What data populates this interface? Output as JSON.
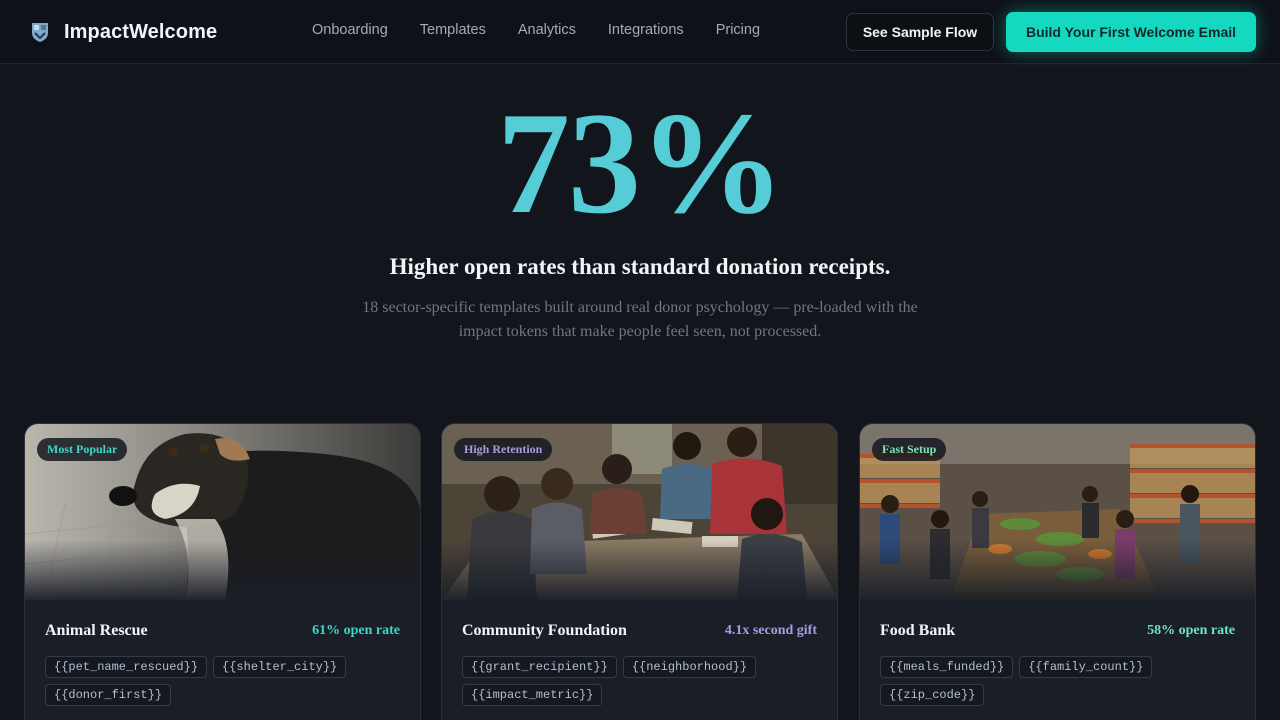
{
  "nav": {
    "brand": "ImpactWelcome",
    "links": [
      "Onboarding",
      "Templates",
      "Analytics",
      "Integrations",
      "Pricing"
    ],
    "secondary_cta": "See Sample Flow",
    "primary_cta": "Build Your First Welcome Email"
  },
  "hero": {
    "stat": "73%",
    "headline": "Higher open rates than standard donation receipts.",
    "subtext": "18 sector-specific templates built around real donor psychology — pre-loaded with the impact tokens that make people feel seen, not processed."
  },
  "colors": {
    "accent": "#14d8c0",
    "stat": "#56ccd6",
    "purple": "#a99be0",
    "background": "#12151c"
  },
  "cards": [
    {
      "badge": "Most Popular",
      "badge_color": "#3fd6c6",
      "title": "Animal Rescue",
      "metric": "61% open rate",
      "metric_color": "#3fd6c6",
      "tokens": [
        "{{pet_name_rescued}}",
        "{{shelter_city}}",
        "{{donor_first}}"
      ]
    },
    {
      "badge": "High Retention",
      "badge_color": "#a99be0",
      "title": "Community Foundation",
      "metric": "4.1x second gift",
      "metric_color": "#a99be0",
      "tokens": [
        "{{grant_recipient}}",
        "{{neighborhood}}",
        "{{impact_metric}}"
      ]
    },
    {
      "badge": "Fast Setup",
      "badge_color": "#7fe3b4",
      "title": "Food Bank",
      "metric": "58% open rate",
      "metric_color": "#6fe3c9",
      "tokens": [
        "{{meals_funded}}",
        "{{family_count}}",
        "{{zip_code}}"
      ]
    }
  ]
}
